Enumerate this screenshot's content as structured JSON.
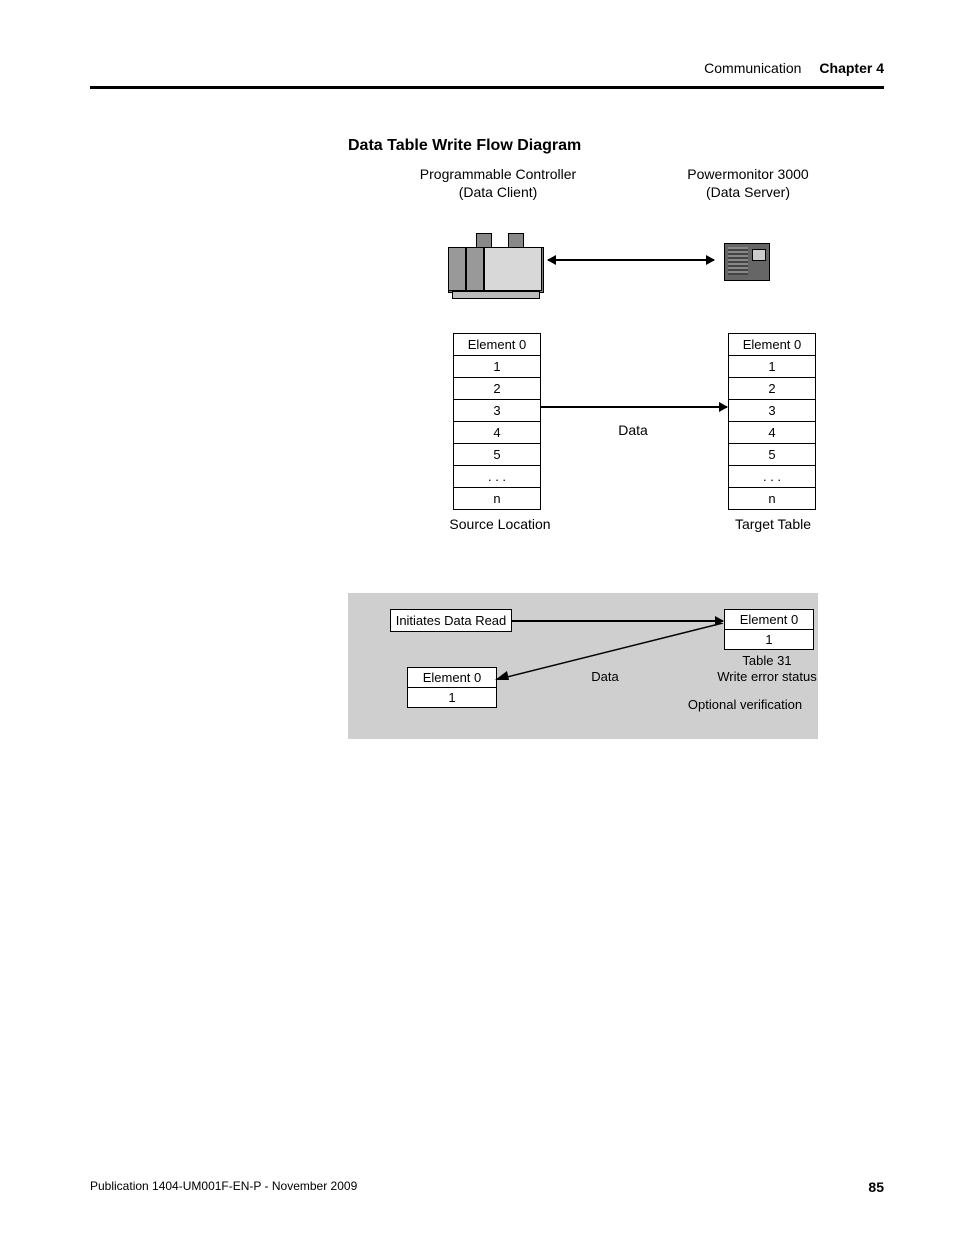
{
  "header": {
    "section": "Communication",
    "chapter": "Chapter 4"
  },
  "title": "Data Table Write Flow Diagram",
  "fig": {
    "left_label_l1": "Programmable Controller",
    "left_label_l2": "(Data Client)",
    "right_label_l1": "Powermonitor 3000",
    "right_label_l2": "(Data Server)",
    "rows": [
      "Element 0",
      "1",
      "2",
      "3",
      "4",
      "5",
      ". . .",
      "n"
    ],
    "left_caption": "Source Location",
    "right_caption": "Target Table",
    "mid": "Data"
  },
  "panel": {
    "initiates": "Initiates Data Read",
    "right_rows": [
      "Element 0",
      "1"
    ],
    "right_lbl_l1": "Table 31",
    "right_lbl_l2": "Write error status",
    "left_rows": [
      "Element 0",
      "1"
    ],
    "mid": "Data",
    "opt": "Optional verification"
  },
  "footer": {
    "pub": "Publication 1404-UM001F-EN-P - November 2009",
    "page": "85"
  }
}
